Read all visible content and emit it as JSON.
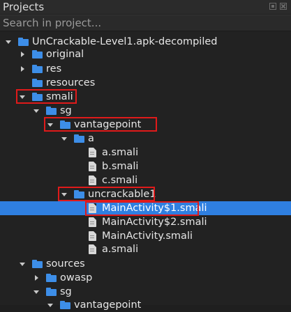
{
  "panel": {
    "title": "Projects",
    "search_placeholder": "Search in project..."
  },
  "tree": {
    "root": "UnCrackable-Level1.apk-decompiled",
    "original": "original",
    "res": "res",
    "resources": "resources",
    "smali": "smali",
    "sg": "sg",
    "vantagepoint": "vantagepoint",
    "a": "a",
    "a_smali": "a.smali",
    "b_smali": "b.smali",
    "c_smali": "c.smali",
    "uncrackable1": "uncrackable1",
    "main_activity_1": "MainActivity$1.smali",
    "main_activity_2": "MainActivity$2.smali",
    "main_activity": "MainActivity.smali",
    "uncrackable_a_smali": "a.smali",
    "sources": "sources",
    "owasp": "owasp",
    "sources_sg": "sg",
    "sources_vantagepoint": "vantagepoint"
  },
  "colors": {
    "background": "#222222",
    "selection": "#2f7fe0",
    "folder": "#3d8ee8",
    "highlight_box": "#e01a1a"
  }
}
